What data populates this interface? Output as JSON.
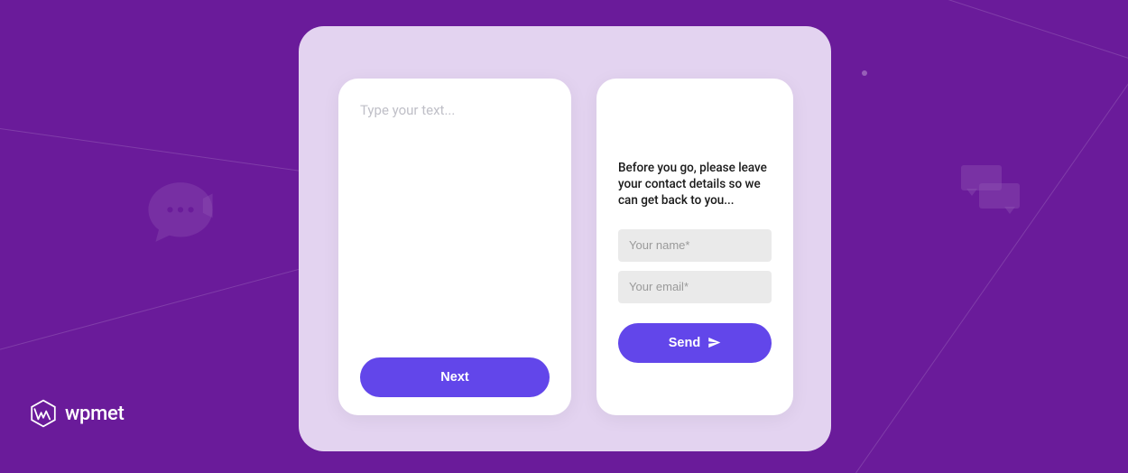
{
  "brand": {
    "name": "wpmet"
  },
  "card_left": {
    "textarea_placeholder": "Type your text...",
    "next_button_label": "Next"
  },
  "card_right": {
    "prompt": "Before you go, please leave your contact details so we can get back to you...",
    "name_placeholder": "Your name*",
    "email_placeholder": "Your email*",
    "send_button_label": "Send"
  }
}
